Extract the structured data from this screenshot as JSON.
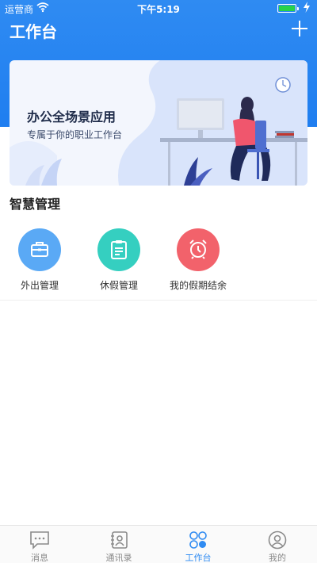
{
  "status_bar": {
    "carrier": "运营商",
    "time": "下午5:19"
  },
  "header": {
    "title": "工作台"
  },
  "banner": {
    "title": "办公全场景应用",
    "subtitle": "专属于你的职业工作台"
  },
  "section": {
    "title": "智慧管理"
  },
  "apps": [
    {
      "label": "外出管理",
      "icon": "briefcase-icon",
      "color": "#5aa9f5"
    },
    {
      "label": "休假管理",
      "icon": "clipboard-icon",
      "color": "#35cfc0"
    },
    {
      "label": "我的假期结余",
      "icon": "alarm-clock-icon",
      "color": "#f2626b"
    }
  ],
  "tabbar": {
    "items": [
      {
        "label": "消息",
        "icon": "message-icon"
      },
      {
        "label": "通讯录",
        "icon": "contacts-icon"
      },
      {
        "label": "工作台",
        "icon": "workbench-icon"
      },
      {
        "label": "我的",
        "icon": "profile-icon"
      }
    ],
    "active_index": 2
  },
  "colors": {
    "primary": "#2f8bf2",
    "battery": "#27d24a"
  }
}
